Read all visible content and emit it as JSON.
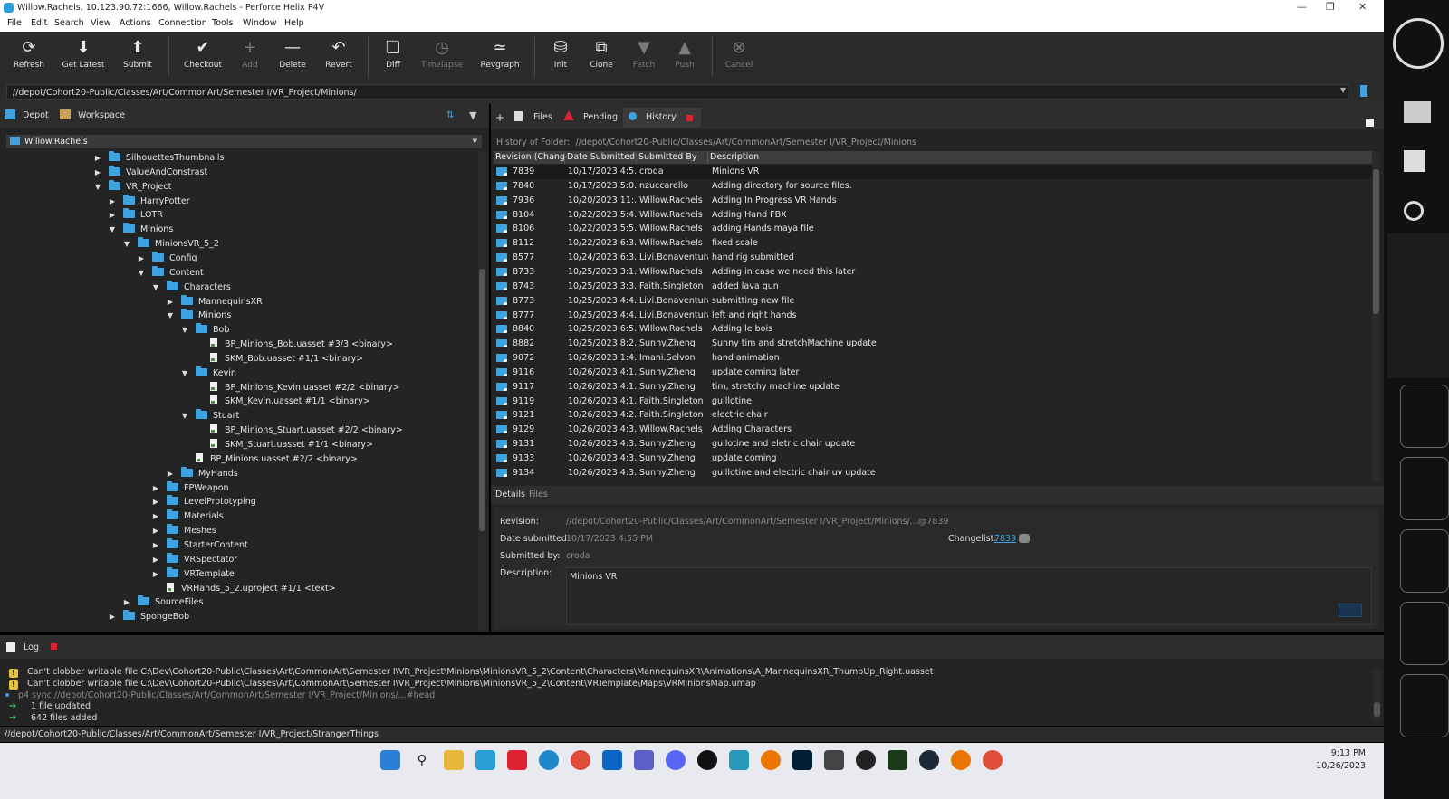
{
  "window": {
    "title": "Willow.Rachels,  10.123.90.72:1666,  Willow.Rachels - Perforce Helix P4V"
  },
  "menu": [
    "File",
    "Edit",
    "Search",
    "View",
    "Actions",
    "Connection",
    "Tools",
    "Window",
    "Help"
  ],
  "toolbar": {
    "buttons": [
      {
        "label": "Refresh",
        "icon": "refresh-icon"
      },
      {
        "label": "Get Latest",
        "icon": "get-latest-icon"
      },
      {
        "label": "Submit",
        "icon": "submit-icon"
      },
      {
        "label": "Checkout",
        "icon": "checkmark-icon"
      },
      {
        "label": "Add",
        "icon": "plus-icon"
      },
      {
        "label": "Delete",
        "icon": "minus-icon"
      },
      {
        "label": "Revert",
        "icon": "undo-icon"
      },
      {
        "label": "Diff",
        "icon": "diff-icon"
      },
      {
        "label": "Timelapse",
        "icon": "timelapse-icon"
      },
      {
        "label": "Revgraph",
        "icon": "revgraph-icon"
      },
      {
        "label": "Init",
        "icon": "init-icon"
      },
      {
        "label": "Clone",
        "icon": "clone-icon"
      },
      {
        "label": "Fetch",
        "icon": "fetch-icon"
      },
      {
        "label": "Push",
        "icon": "push-icon"
      },
      {
        "label": "Cancel",
        "icon": "cancel-icon"
      }
    ]
  },
  "address": {
    "path": "//depot/Cohort20-Public/Classes/Art/CommonArt/Semester I/VR_Project/Minions/"
  },
  "left": {
    "tabs": {
      "depot": "Depot",
      "workspace": "Workspace"
    },
    "workspace": "Willow.Rachels",
    "tree": [
      {
        "label": "SilhouettesThumbnails",
        "type": "folder",
        "depth": 0,
        "state": "collapsed"
      },
      {
        "label": "ValueAndConstrast",
        "type": "folder",
        "depth": 0,
        "state": "collapsed"
      },
      {
        "label": "VR_Project",
        "type": "folder",
        "depth": 0,
        "state": "expanded"
      },
      {
        "label": "HarryPotter",
        "type": "folder",
        "depth": 1,
        "state": "collapsed"
      },
      {
        "label": "LOTR",
        "type": "folder",
        "depth": 1,
        "state": "collapsed"
      },
      {
        "label": "Minions",
        "type": "folder",
        "depth": 1,
        "state": "expanded"
      },
      {
        "label": "MinionsVR_5_2",
        "type": "folder",
        "depth": 2,
        "state": "expanded"
      },
      {
        "label": "Config",
        "type": "folder",
        "depth": 3,
        "state": "collapsed"
      },
      {
        "label": "Content",
        "type": "folder",
        "depth": 3,
        "state": "expanded"
      },
      {
        "label": "Characters",
        "type": "folder",
        "depth": 4,
        "state": "expanded"
      },
      {
        "label": "MannequinsXR",
        "type": "folder",
        "depth": 5,
        "state": "collapsed"
      },
      {
        "label": "Minions",
        "type": "folder",
        "depth": 5,
        "state": "expanded"
      },
      {
        "label": "Bob",
        "type": "folder",
        "depth": 6,
        "state": "expanded"
      },
      {
        "label": "BP_Minions_Bob.uasset #3/3 <binary>",
        "type": "file",
        "depth": 7
      },
      {
        "label": "SKM_Bob.uasset #1/1 <binary>",
        "type": "file",
        "depth": 7
      },
      {
        "label": "Kevin",
        "type": "folder",
        "depth": 6,
        "state": "expanded"
      },
      {
        "label": "BP_Minions_Kevin.uasset #2/2 <binary>",
        "type": "file",
        "depth": 7
      },
      {
        "label": "SKM_Kevin.uasset #1/1 <binary>",
        "type": "file",
        "depth": 7
      },
      {
        "label": "Stuart",
        "type": "folder",
        "depth": 6,
        "state": "expanded"
      },
      {
        "label": "BP_Minions_Stuart.uasset #2/2 <binary>",
        "type": "file",
        "depth": 7
      },
      {
        "label": "SKM_Stuart.uasset #1/1 <binary>",
        "type": "file",
        "depth": 7
      },
      {
        "label": "BP_Minions.uasset #2/2 <binary>",
        "type": "file",
        "depth": 6
      },
      {
        "label": "MyHands",
        "type": "folder",
        "depth": 5,
        "state": "collapsed"
      },
      {
        "label": "FPWeapon",
        "type": "folder",
        "depth": 4,
        "state": "collapsed"
      },
      {
        "label": "LevelPrototyping",
        "type": "folder",
        "depth": 4,
        "state": "collapsed"
      },
      {
        "label": "Materials",
        "type": "folder",
        "depth": 4,
        "state": "collapsed"
      },
      {
        "label": "Meshes",
        "type": "folder",
        "depth": 4,
        "state": "collapsed"
      },
      {
        "label": "StarterContent",
        "type": "folder",
        "depth": 4,
        "state": "collapsed"
      },
      {
        "label": "VRSpectator",
        "type": "folder",
        "depth": 4,
        "state": "collapsed"
      },
      {
        "label": "VRTemplate",
        "type": "folder",
        "depth": 4,
        "state": "collapsed"
      },
      {
        "label": "VRHands_5_2.uproject #1/1 <text>",
        "type": "file",
        "depth": 4
      },
      {
        "label": "SourceFiles",
        "type": "folder",
        "depth": 2,
        "state": "collapsed"
      },
      {
        "label": "SpongeBob",
        "type": "folder",
        "depth": 1,
        "state": "collapsed"
      }
    ]
  },
  "right": {
    "tabs": {
      "files": "Files",
      "pending": "Pending",
      "history": "History"
    },
    "history_label": "History of Folder:",
    "history_path": "//depot/Cohort20-Public/Classes/Art/CommonArt/Semester I/VR_Project/Minions",
    "columns": [
      "Revision (Chang",
      "Date Submitted",
      "Submitted By",
      "Description"
    ],
    "rows": [
      [
        "7839",
        "10/17/2023 4:5...",
        "croda",
        "Minions VR"
      ],
      [
        "7840",
        "10/17/2023 5:0...",
        "nzuccarello",
        "Adding directory for source files."
      ],
      [
        "7936",
        "10/20/2023 11:...",
        "Willow.Rachels",
        "Adding In Progress VR Hands"
      ],
      [
        "8104",
        "10/22/2023 5:4...",
        "Willow.Rachels",
        "Adding Hand FBX"
      ],
      [
        "8106",
        "10/22/2023 5:5...",
        "Willow.Rachels",
        "adding Hands maya file"
      ],
      [
        "8112",
        "10/22/2023 6:3...",
        "Willow.Rachels",
        "fixed scale"
      ],
      [
        "8577",
        "10/24/2023 6:3...",
        "Livi.Bonaventura",
        "hand rig submitted"
      ],
      [
        "8733",
        "10/25/2023 3:1...",
        "Willow.Rachels",
        "Adding in case we need this later"
      ],
      [
        "8743",
        "10/25/2023 3:3...",
        "Faith.Singleton",
        "added lava gun"
      ],
      [
        "8773",
        "10/25/2023 4:4...",
        "Livi.Bonaventura",
        "submitting new file"
      ],
      [
        "8777",
        "10/25/2023 4:4...",
        "Livi.Bonaventura",
        "left and right hands"
      ],
      [
        "8840",
        "10/25/2023 6:5...",
        "Willow.Rachels",
        "Adding le bois"
      ],
      [
        "8882",
        "10/25/2023 8:2...",
        "Sunny.Zheng",
        "Sunny tim and stretchMachine update"
      ],
      [
        "9072",
        "10/26/2023 1:4...",
        "Imani.Selvon",
        "hand animation"
      ],
      [
        "9116",
        "10/26/2023 4:1...",
        "Sunny.Zheng",
        "update coming later"
      ],
      [
        "9117",
        "10/26/2023 4:1...",
        "Sunny.Zheng",
        "tim, stretchy machine update"
      ],
      [
        "9119",
        "10/26/2023 4:1...",
        "Faith.Singleton",
        "guillotine"
      ],
      [
        "9121",
        "10/26/2023 4:2...",
        "Faith.Singleton",
        "electric chair"
      ],
      [
        "9129",
        "10/26/2023 4:3...",
        "Willow.Rachels",
        "Adding Characters"
      ],
      [
        "9131",
        "10/26/2023 4:3...",
        "Sunny.Zheng",
        "guilotine and eletric chair update"
      ],
      [
        "9133",
        "10/26/2023 4:3...",
        "Sunny.Zheng",
        "update coming"
      ],
      [
        "9134",
        "10/26/2023 4:3...",
        "Sunny.Zheng",
        "guillotine and electric chair uv update"
      ]
    ],
    "detail_tabs": {
      "details": "Details",
      "files": "Files"
    },
    "details": {
      "revision_label": "Revision:",
      "revision_value": "//depot/Cohort20-Public/Classes/Art/CommonArt/Semester I/VR_Project/Minions/...@7839",
      "date_label": "Date submitted:",
      "date_value": "10/17/2023 4:55 PM",
      "changelist_label": "Changelist:",
      "changelist_value": "7839",
      "by_label": "Submitted by:",
      "by_value": "croda",
      "desc_label": "Description:",
      "desc_value": "Minions VR"
    }
  },
  "log": {
    "tab": "Log",
    "lines": [
      {
        "type": "warn",
        "text": "Can't clobber writable file C:\\Dev\\Cohort20-Public\\Classes\\Art\\CommonArt\\Semester I\\VR_Project\\Minions\\MinionsVR_5_2\\Content\\Characters\\MannequinsXR\\Animations\\A_MannequinsXR_ThumbUp_Right.uasset"
      },
      {
        "type": "warn",
        "text": "Can't clobber writable file C:\\Dev\\Cohort20-Public\\Classes\\Art\\CommonArt\\Semester I\\VR_Project\\Minions\\MinionsVR_5_2\\Content\\VRTemplate\\Maps\\VRMinionsMap.umap"
      },
      {
        "type": "cmd",
        "text": "p4 sync //depot/Cohort20-Public/Classes/Art/CommonArt/Semester I/VR_Project/Minions/...#head"
      },
      {
        "type": "ok",
        "text": "1 file updated"
      },
      {
        "type": "ok",
        "text": "642 files added"
      }
    ]
  },
  "status": {
    "text": "//depot/Cohort20-Public/Classes/Art/CommonArt/Semester I/VR_Project/StrangerThings"
  },
  "taskbar": {
    "time": "9:13 PM",
    "date": "10/26/2023"
  }
}
